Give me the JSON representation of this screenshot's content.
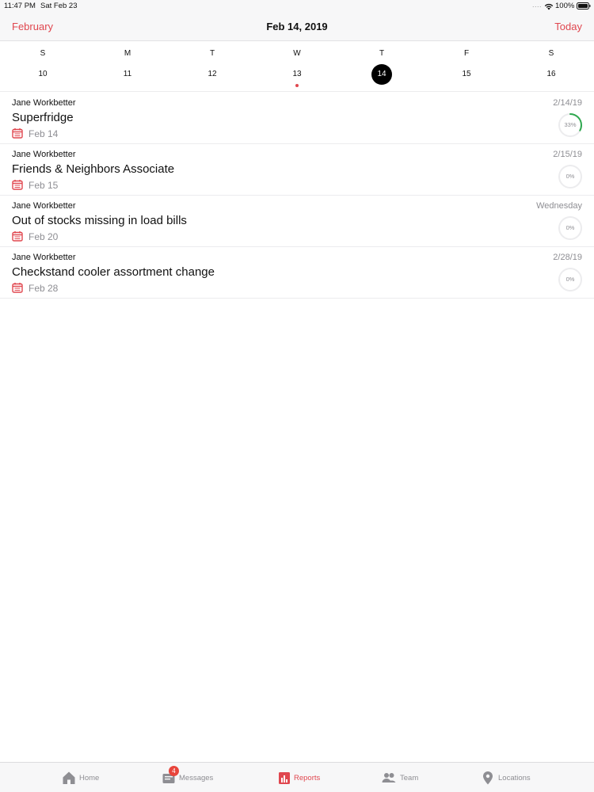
{
  "status_bar": {
    "time": "11:47 PM",
    "date": "Sat Feb 23",
    "signal": "....",
    "battery": "100%"
  },
  "nav": {
    "back_label": "February",
    "title": "Feb 14, 2019",
    "today_label": "Today",
    "accent_color": "#e0474f"
  },
  "week": {
    "days": [
      {
        "letter": "S",
        "number": "10",
        "selected": false,
        "has_event": false
      },
      {
        "letter": "M",
        "number": "11",
        "selected": false,
        "has_event": false
      },
      {
        "letter": "T",
        "number": "12",
        "selected": false,
        "has_event": false
      },
      {
        "letter": "W",
        "number": "13",
        "selected": false,
        "has_event": true
      },
      {
        "letter": "T",
        "number": "14",
        "selected": true,
        "has_event": false
      },
      {
        "letter": "F",
        "number": "15",
        "selected": false,
        "has_event": false
      },
      {
        "letter": "S",
        "number": "16",
        "selected": false,
        "has_event": false
      }
    ]
  },
  "reports": [
    {
      "assignee": "Jane Workbetter",
      "date": "2/14/19",
      "title": "Superfridge",
      "due": "Feb 14",
      "progress": 33,
      "progress_label": "33%",
      "progress_color": "#2fa84f"
    },
    {
      "assignee": "Jane Workbetter",
      "date": "2/15/19",
      "title": "Friends & Neighbors Associate",
      "due": "Feb 15",
      "progress": 0,
      "progress_label": "0%",
      "progress_color": "#2fa84f"
    },
    {
      "assignee": "Jane Workbetter",
      "date": "Wednesday",
      "title": "Out of stocks missing in load bills",
      "due": "Feb 20",
      "progress": 0,
      "progress_label": "0%",
      "progress_color": "#2fa84f"
    },
    {
      "assignee": "Jane Workbetter",
      "date": "2/28/19",
      "title": "Checkstand cooler assortment change",
      "due": "Feb 28",
      "progress": 0,
      "progress_label": "0%",
      "progress_color": "#2fa84f"
    }
  ],
  "tabs": {
    "home": {
      "label": "Home",
      "icon": "home-icon"
    },
    "messages": {
      "label": "Messages",
      "icon": "inbox-icon",
      "badge": "4"
    },
    "reports": {
      "label": "Reports",
      "icon": "bar-chart-icon",
      "active": true
    },
    "team": {
      "label": "Team",
      "icon": "people-icon"
    },
    "locations": {
      "label": "Locations",
      "icon": "map-pin-icon"
    }
  }
}
